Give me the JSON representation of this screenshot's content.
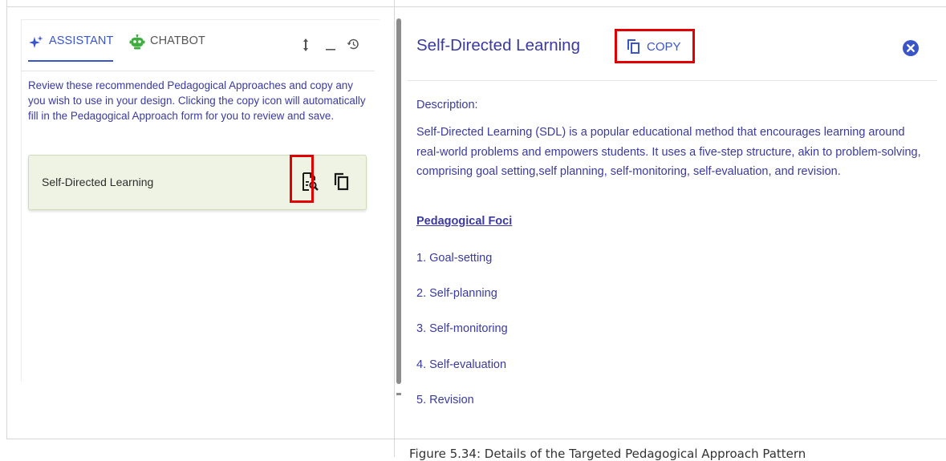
{
  "assistant_panel": {
    "tabs": [
      {
        "label": "ASSISTANT",
        "icon": "sparkle-icon",
        "active": true
      },
      {
        "label": "CHATBOT",
        "icon": "robot-icon",
        "active": false
      }
    ],
    "controls": [
      "resize-icon",
      "minimize-icon",
      "history-icon"
    ],
    "intro": "Review these recommended Pedagogical Approaches and copy any you wish to use in your design. Clicking the copy icon will automatically fill in the Pedagogical Approach form for you to review and save.",
    "recommendations": [
      {
        "title": "Self-Directed Learning"
      }
    ]
  },
  "detail": {
    "title": "Self-Directed Learning",
    "copy_label": "COPY",
    "description_label": "Description:",
    "description": "Self-Directed Learning (SDL) is a popular educational method that encourages learning around real-world problems and empowers students. It uses a five-step structure, akin to problem-solving, comprising goal setting,self planning, self-monitoring, self-evaluation, and revision.",
    "foci_label": "Pedagogical Foci",
    "foci": [
      "1. Goal-setting",
      "2. Self-planning",
      "3. Self-monitoring",
      "4. Self-evaluation",
      "5. Revision"
    ]
  },
  "caption": "Figure 5.34: Details of the Targeted Pedagogical Approach Pattern",
  "colors": {
    "accent": "#3a55c9",
    "text": "#3a3aa0",
    "card_bg": "#eef3e3",
    "highlight": "#e30000",
    "chatbot_icon": "#3fae3f"
  }
}
